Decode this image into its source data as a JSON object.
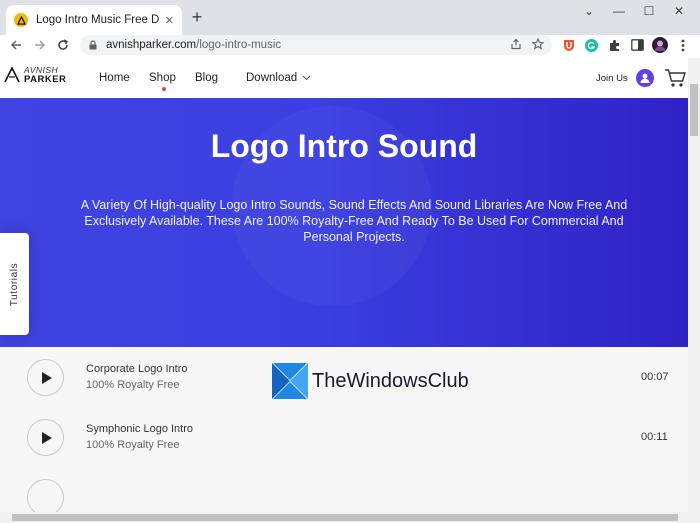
{
  "browser": {
    "tab_title": "Logo Intro Music Free Download",
    "tab_close": "✕",
    "new_tab": "+",
    "url_host": "avnishparker.com",
    "url_path": "/logo-intro-music",
    "controls": {
      "chevron": "⌄",
      "minimize": "—",
      "maximize": "☐",
      "close": "✕"
    }
  },
  "site": {
    "logo_line1": "AVNISH",
    "logo_line2": "PARKER",
    "nav": [
      "Home",
      "Shop",
      "Blog",
      "Download"
    ],
    "join": "Join Us",
    "side_tab": "Tutorials"
  },
  "hero": {
    "title": "Logo Intro Sound",
    "description": "A Variety Of High-quality Logo Intro Sounds, Sound Effects And Sound Libraries Are Now Free And Exclusively Available. These Are 100% Royalty-Free And Ready To Be Used For Commercial And Personal Projects."
  },
  "tracks": [
    {
      "name": "Corporate Logo Intro",
      "license": "100% Royalty Free",
      "duration": "00:07"
    },
    {
      "name": "Symphonic Logo Intro",
      "license": "100% Royalty Free",
      "duration": "00:11"
    }
  ],
  "watermark": "TheWindowsClub",
  "colors": {
    "hero": "#3b3fe0",
    "accent": "#5b43e8",
    "shop_dot": "#e8453c"
  }
}
